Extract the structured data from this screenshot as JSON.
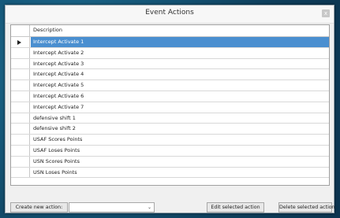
{
  "window": {
    "title": "Event Actions",
    "close_glyph": "x"
  },
  "grid": {
    "column_header": "Description",
    "rows": [
      {
        "label": "Intercept Activate 1",
        "selected": true
      },
      {
        "label": "Intercept Activate 2"
      },
      {
        "label": "Intercept Activate 3"
      },
      {
        "label": "Intercept Activate 4"
      },
      {
        "label": "Intercept Activate 5"
      },
      {
        "label": "Intercept Activate 6"
      },
      {
        "label": "Intercept Activate 7"
      },
      {
        "label": "defensive shift 1"
      },
      {
        "label": "defensive shift 2"
      },
      {
        "label": "USAF Scores Points"
      },
      {
        "label": "USAF Loses Points"
      },
      {
        "label": "USN Scores Points"
      },
      {
        "label": "USN Loses Points"
      }
    ]
  },
  "actions": {
    "create_label": "Create new action:",
    "combo_value": "",
    "edit_label": "Edit selected action",
    "delete_label": "Delete selected action"
  },
  "colors": {
    "selection": "#4a8fd0",
    "background": "#155677"
  },
  "icons": {
    "close": "close-icon",
    "row_pointer": "row-pointer-icon",
    "dropdown": "chevron-down-icon"
  }
}
